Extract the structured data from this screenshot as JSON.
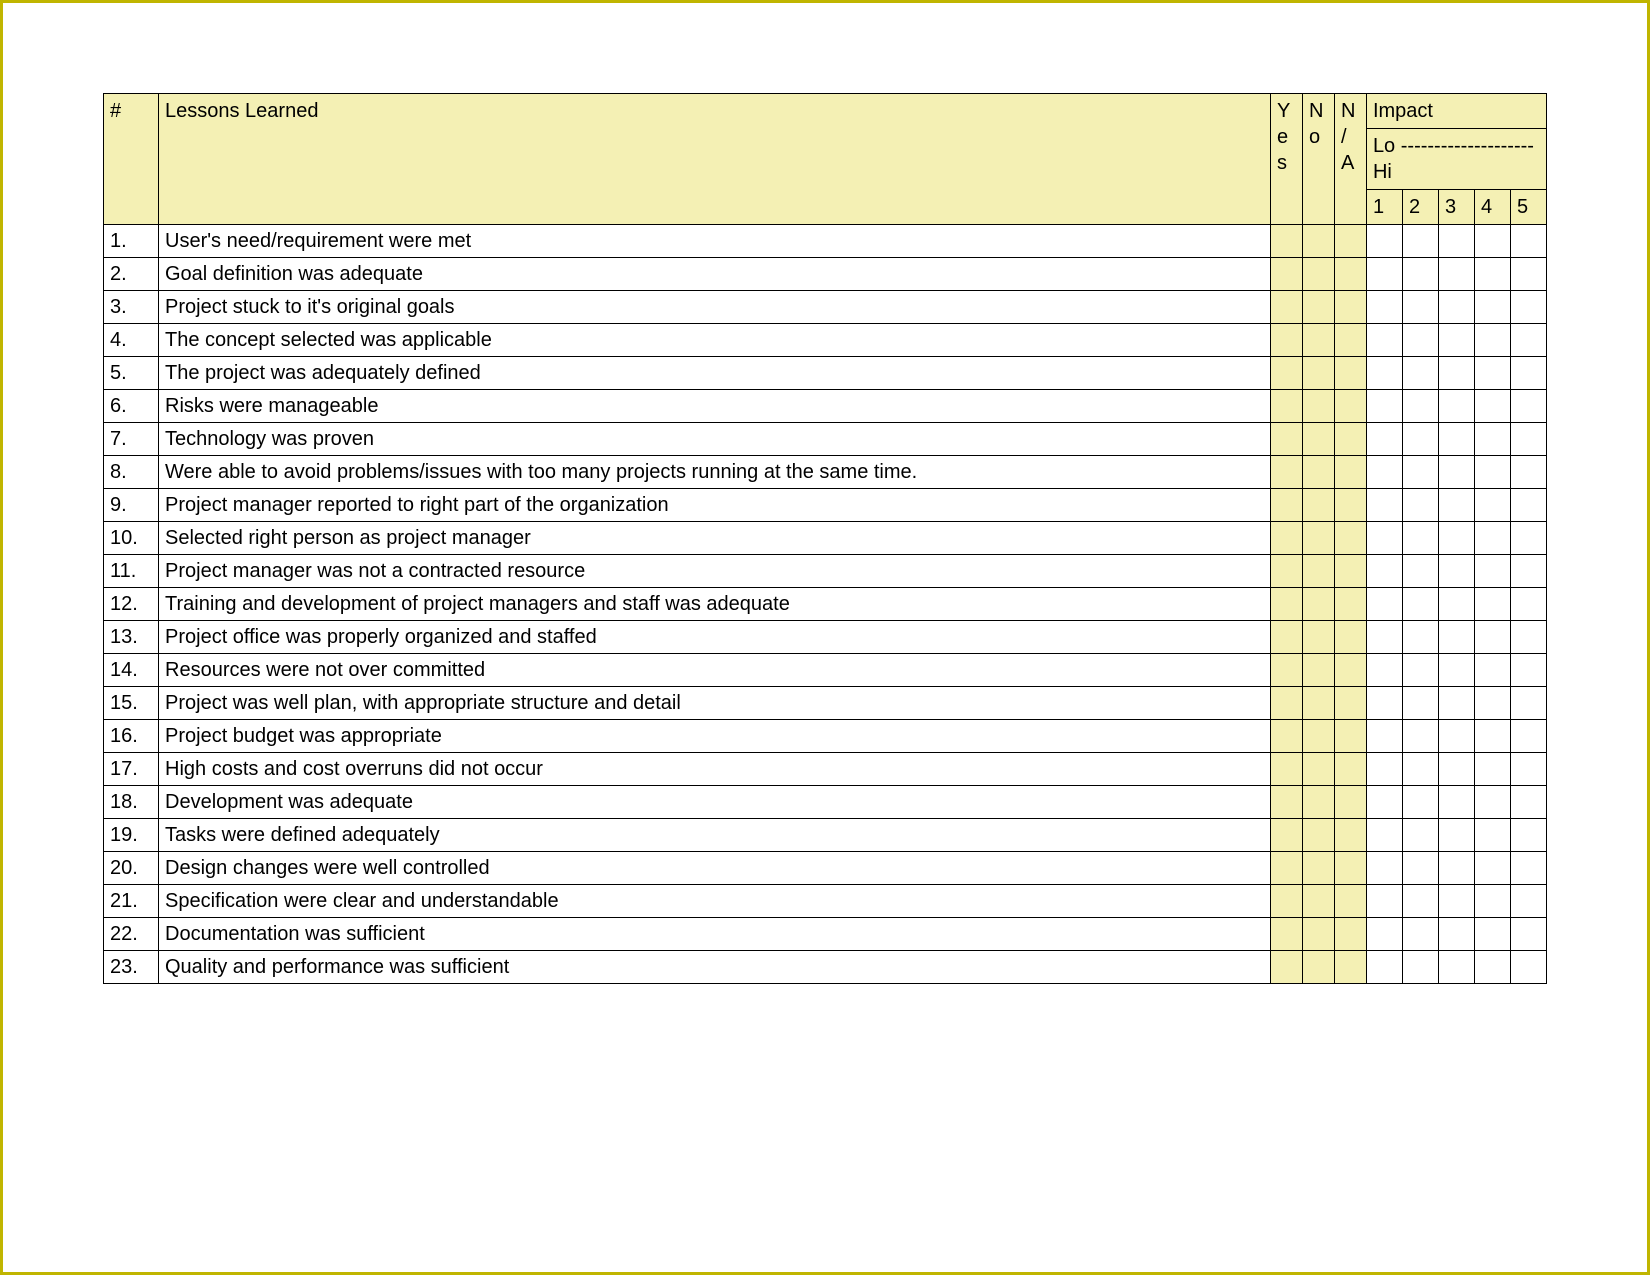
{
  "header": {
    "num": "#",
    "title": "Lessons Learned",
    "yes": "Yes",
    "no": "No",
    "na": "N/A",
    "impact": "Impact",
    "lo": "Lo",
    "hi": "Hi",
    "scale": [
      "1",
      "2",
      "3",
      "4",
      "5"
    ]
  },
  "rows": [
    {
      "num": "1.",
      "text": "User's need/requirement were met"
    },
    {
      "num": "2.",
      "text": "Goal definition was adequate"
    },
    {
      "num": "3.",
      "text": "Project stuck to it's original goals"
    },
    {
      "num": "4.",
      "text": "The concept selected was applicable"
    },
    {
      "num": "5.",
      "text": "The project was adequately defined"
    },
    {
      "num": "6.",
      "text": "Risks were manageable"
    },
    {
      "num": "7.",
      "text": "Technology was proven"
    },
    {
      "num": "8.",
      "text": "Were able to avoid problems/issues with too many projects running at the same time."
    },
    {
      "num": "9.",
      "text": "Project manager reported to right part of the organization"
    },
    {
      "num": "10.",
      "text": "Selected right person as project manager"
    },
    {
      "num": "11.",
      "text": "Project manager was not a contracted resource"
    },
    {
      "num": "12.",
      "text": "Training and development of project managers and staff was adequate"
    },
    {
      "num": "13.",
      "text": "Project office was properly organized and staffed"
    },
    {
      "num": "14.",
      "text": "Resources were not over committed"
    },
    {
      "num": "15.",
      "text": "Project was well plan, with appropriate structure and detail"
    },
    {
      "num": "16.",
      "text": "Project budget was appropriate"
    },
    {
      "num": "17.",
      "text": "High costs and cost overruns did not occur"
    },
    {
      "num": "18.",
      "text": "Development was adequate"
    },
    {
      "num": "19.",
      "text": "Tasks were defined adequately"
    },
    {
      "num": "20.",
      "text": "Design changes were well controlled"
    },
    {
      "num": "21.",
      "text": "Specification were clear and understandable"
    },
    {
      "num": "22.",
      "text": "Documentation was sufficient"
    },
    {
      "num": "23.",
      "text": "Quality and performance was sufficient"
    }
  ]
}
